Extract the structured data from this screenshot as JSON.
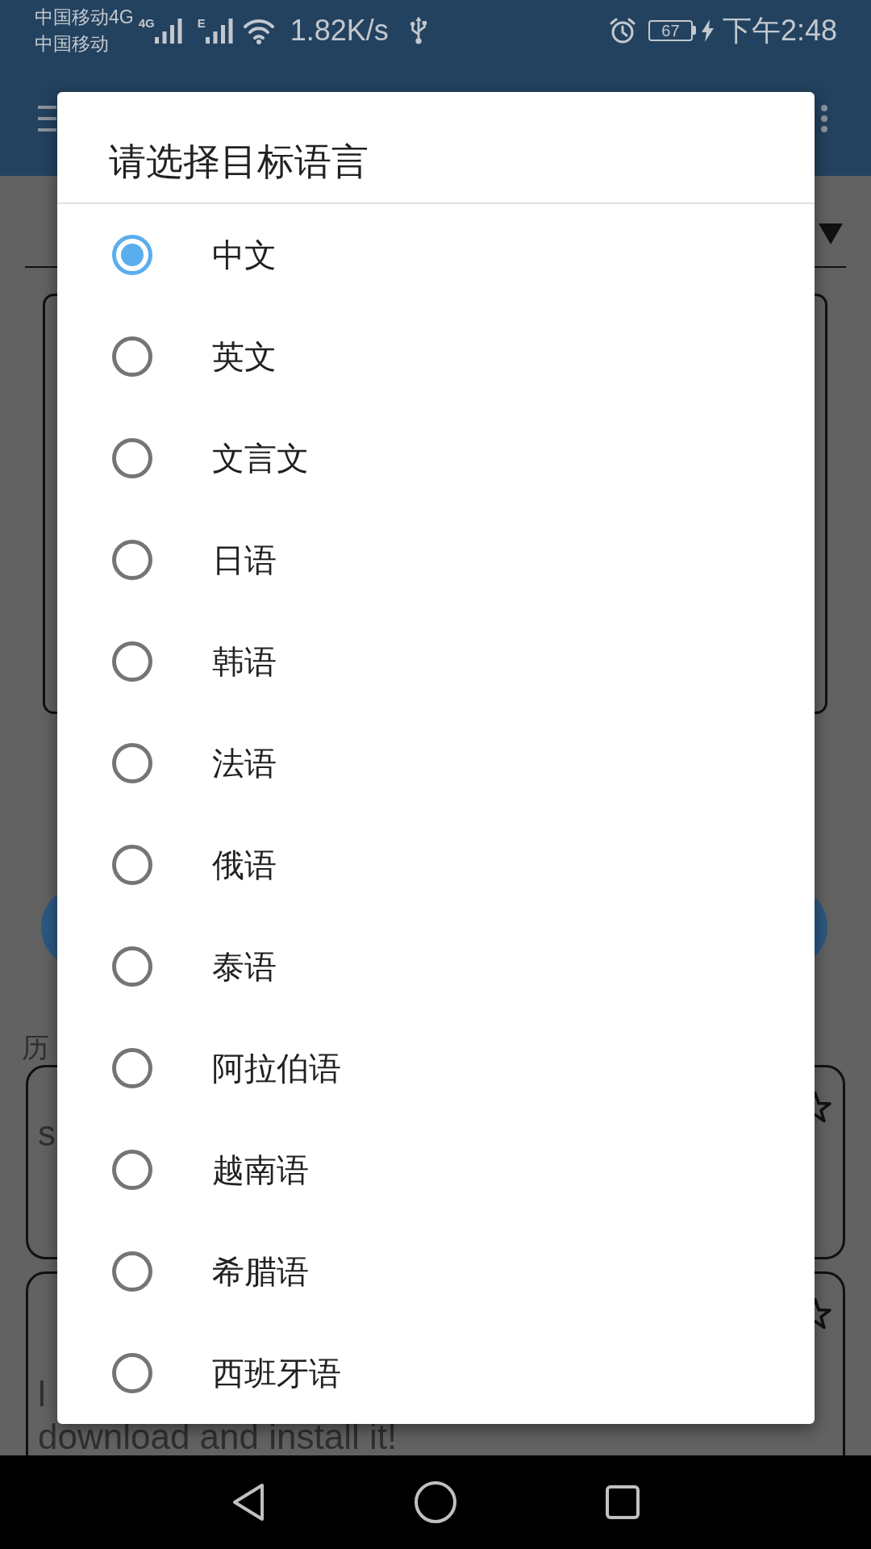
{
  "status_bar": {
    "carriers": [
      "中国移动4G",
      "中国移动"
    ],
    "signals": [
      {
        "network": "4G"
      },
      {
        "network": "E"
      }
    ],
    "speed": "1.82K/s",
    "battery": "67",
    "time": "下午2:48"
  },
  "history": {
    "heading": "历",
    "cards": [
      {
        "lines": [
          "s"
        ]
      },
      {
        "lines": [
          "l",
          "download and install it!"
        ]
      }
    ]
  },
  "dialog": {
    "title": "请选择目标语言",
    "options": [
      {
        "label": "中文",
        "selected": true
      },
      {
        "label": "英文",
        "selected": false
      },
      {
        "label": "文言文",
        "selected": false
      },
      {
        "label": "日语",
        "selected": false
      },
      {
        "label": "韩语",
        "selected": false
      },
      {
        "label": "法语",
        "selected": false
      },
      {
        "label": "俄语",
        "selected": false
      },
      {
        "label": "泰语",
        "selected": false
      },
      {
        "label": "阿拉伯语",
        "selected": false
      },
      {
        "label": "越南语",
        "selected": false
      },
      {
        "label": "希腊语",
        "selected": false
      },
      {
        "label": "西班牙语",
        "selected": false
      }
    ]
  }
}
